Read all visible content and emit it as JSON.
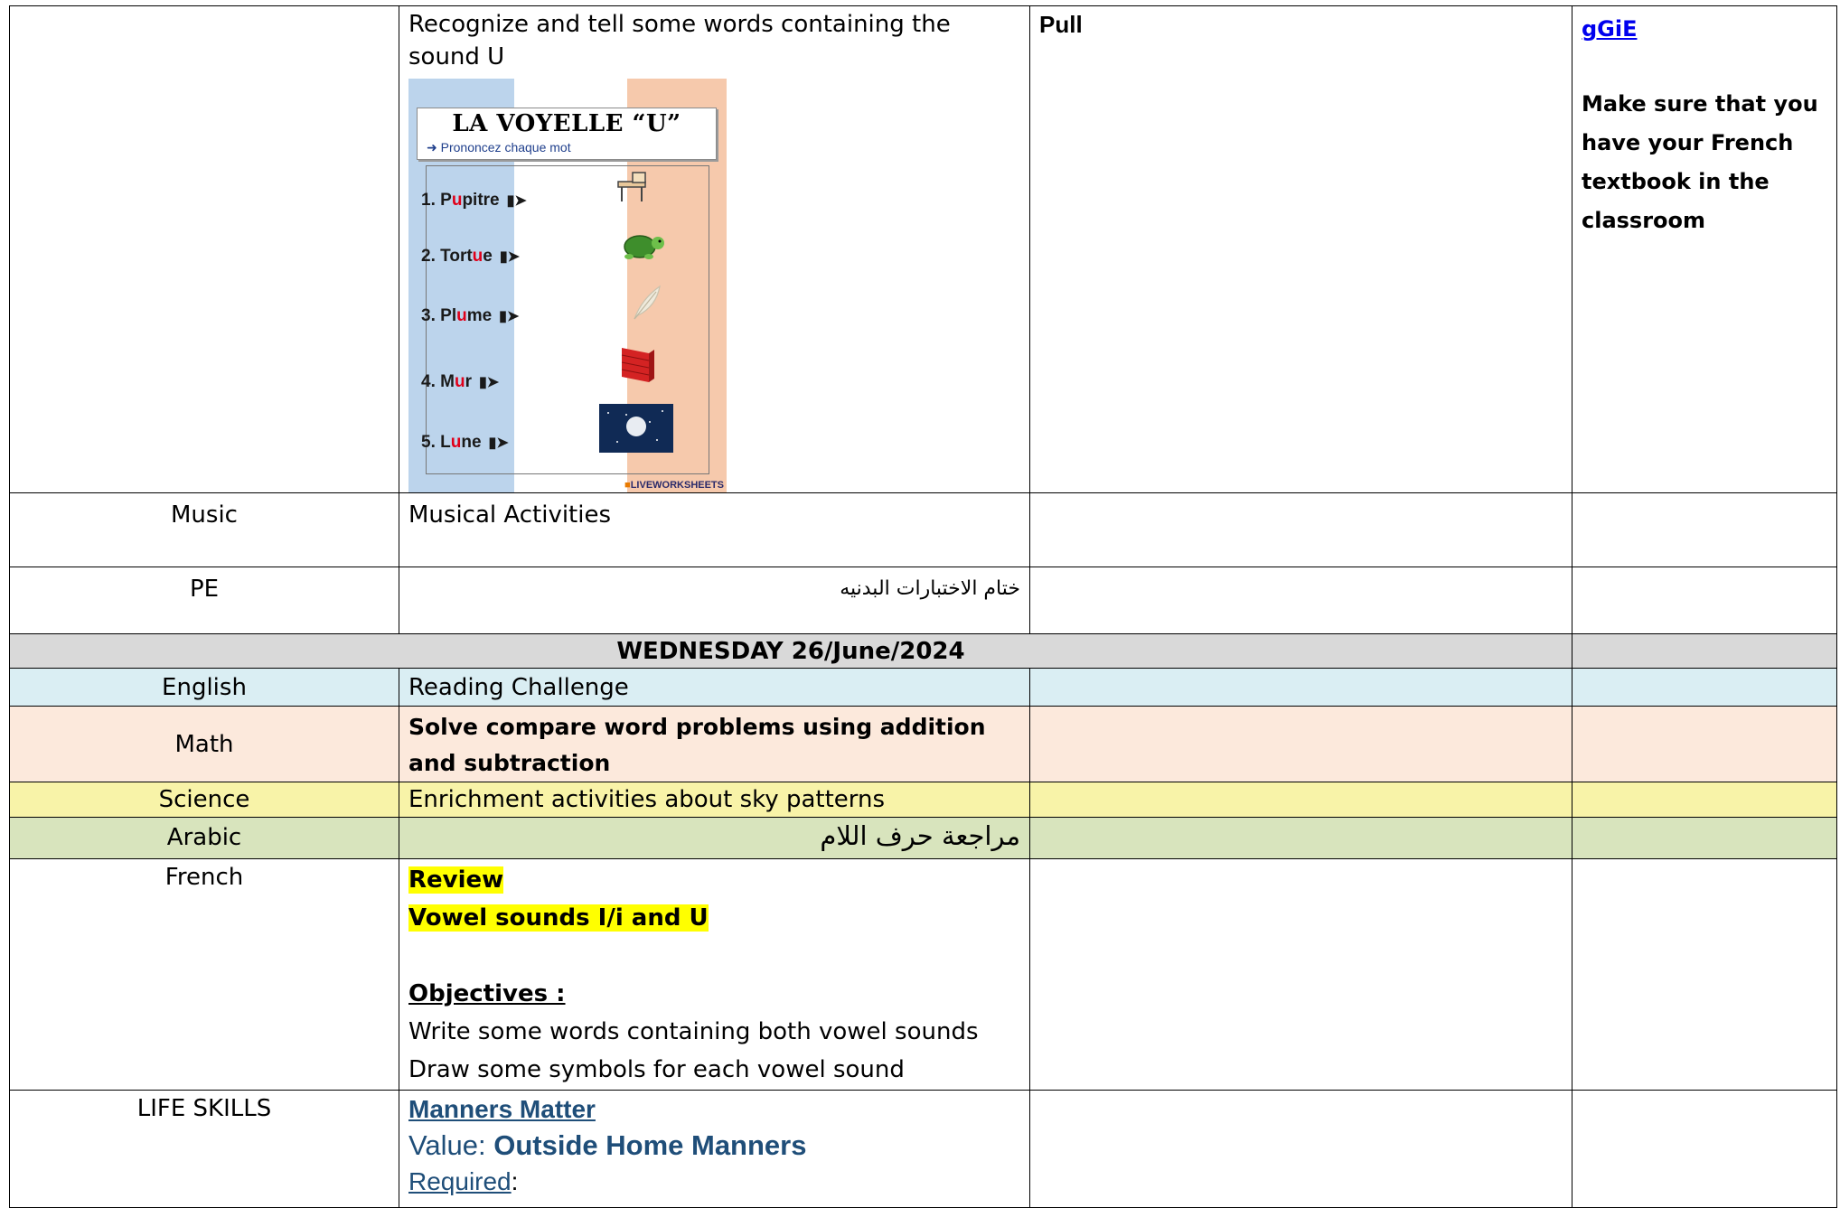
{
  "colors": {
    "date_row": "#d9d9d9",
    "english_row": "#daeef3",
    "math_row": "#fce9dc",
    "science_row": "#f8f3a8",
    "arabic_row": "#d8e4bd",
    "highlight": "#ffff00",
    "link": "#0000ee",
    "life_skills_text": "#1f4e79"
  },
  "french_prev": {
    "objective": "Recognize and tell some words containing the sound U",
    "worksheet": {
      "title": "LA VOYELLE “U”",
      "subtitle": "Prononcez chaque mot",
      "credit": "LIVEWORKSHEETS",
      "words": [
        {
          "num": "1.",
          "pre": "P",
          "mid": "u",
          "post": "pitre",
          "icon": "desk-icon"
        },
        {
          "num": "2.",
          "pre": "Tort",
          "mid": "u",
          "post": "e",
          "icon": "turtle-icon"
        },
        {
          "num": "3.",
          "pre": "Pl",
          "mid": "u",
          "post": "me",
          "icon": "feather-icon"
        },
        {
          "num": "4.",
          "pre": "M",
          "mid": "u",
          "post": "r",
          "icon": "wall-icon"
        },
        {
          "num": "5.",
          "pre": "L",
          "mid": "u",
          "post": "ne",
          "icon": "moon-icon"
        }
      ]
    },
    "method": "Pull",
    "link_text": "gGiE",
    "note": "Make sure that you have your French textbook in the classroom"
  },
  "music": {
    "subject": "Music",
    "activity": "Musical Activities"
  },
  "pe": {
    "subject": "PE",
    "activity": "ختام الاختبارات البدنيه"
  },
  "wednesday": {
    "date": "WEDNESDAY 26/June/2024"
  },
  "english": {
    "subject": "English",
    "activity": "Reading Challenge"
  },
  "math": {
    "subject": "Math",
    "activity": "Solve compare word problems using addition and subtraction"
  },
  "science": {
    "subject": "Science",
    "activity": "Enrichment activities about sky patterns"
  },
  "arabic": {
    "subject": "Arabic",
    "activity": "مراجعة حرف اللام"
  },
  "french": {
    "subject": "French",
    "review": "Review",
    "topic": "Vowel sounds I/i and U",
    "objectives_label": "Objectives :",
    "objective_1": "Write some words containing both vowel sounds",
    "objective_2": "Draw some symbols for each vowel sound"
  },
  "life_skills": {
    "subject": "LIFE SKILLS",
    "title": "Manners Matter",
    "value_label": "Value:",
    "value": "Outside Home Manners",
    "required_label": "Required",
    "required_colon": ":"
  }
}
